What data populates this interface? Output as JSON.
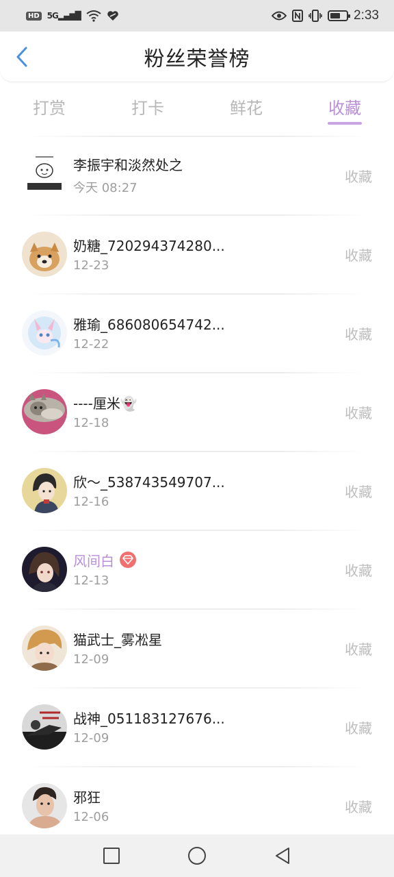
{
  "status_bar": {
    "network_badge": "HD",
    "signal_label": "5G",
    "time": "2:33"
  },
  "header": {
    "title": "粉丝荣誉榜"
  },
  "tabs": [
    {
      "label": "打赏",
      "active": false
    },
    {
      "label": "打卡",
      "active": false
    },
    {
      "label": "鲜花",
      "active": false
    },
    {
      "label": "收藏",
      "active": true
    }
  ],
  "fans": [
    {
      "name": "李振宇和淡然处之",
      "date": "今天 08:27",
      "action": "收藏"
    },
    {
      "name": "奶糖_720294374280...",
      "date": "12-23",
      "action": "收藏"
    },
    {
      "name": "雅瑜_686080654742...",
      "date": "12-22",
      "action": "收藏"
    },
    {
      "name": "----厘米👻",
      "date": "12-18",
      "action": "收藏"
    },
    {
      "name": "欣～_538743549707...",
      "date": "12-16",
      "action": "收藏"
    },
    {
      "name": "风间白",
      "date": "12-13",
      "action": "收藏",
      "vip": true
    },
    {
      "name": "猫武士_雾凇星",
      "date": "12-09",
      "action": "收藏"
    },
    {
      "name": "战神_051183127676...",
      "date": "12-09",
      "action": "收藏"
    },
    {
      "name": "邪狂",
      "date": "12-06",
      "action": "收藏"
    }
  ],
  "colors": {
    "accent": "#b98fd8",
    "inactive_tab": "#b7b7b7",
    "action_text": "#bdbdbd",
    "vip_badge": "#f07070"
  }
}
